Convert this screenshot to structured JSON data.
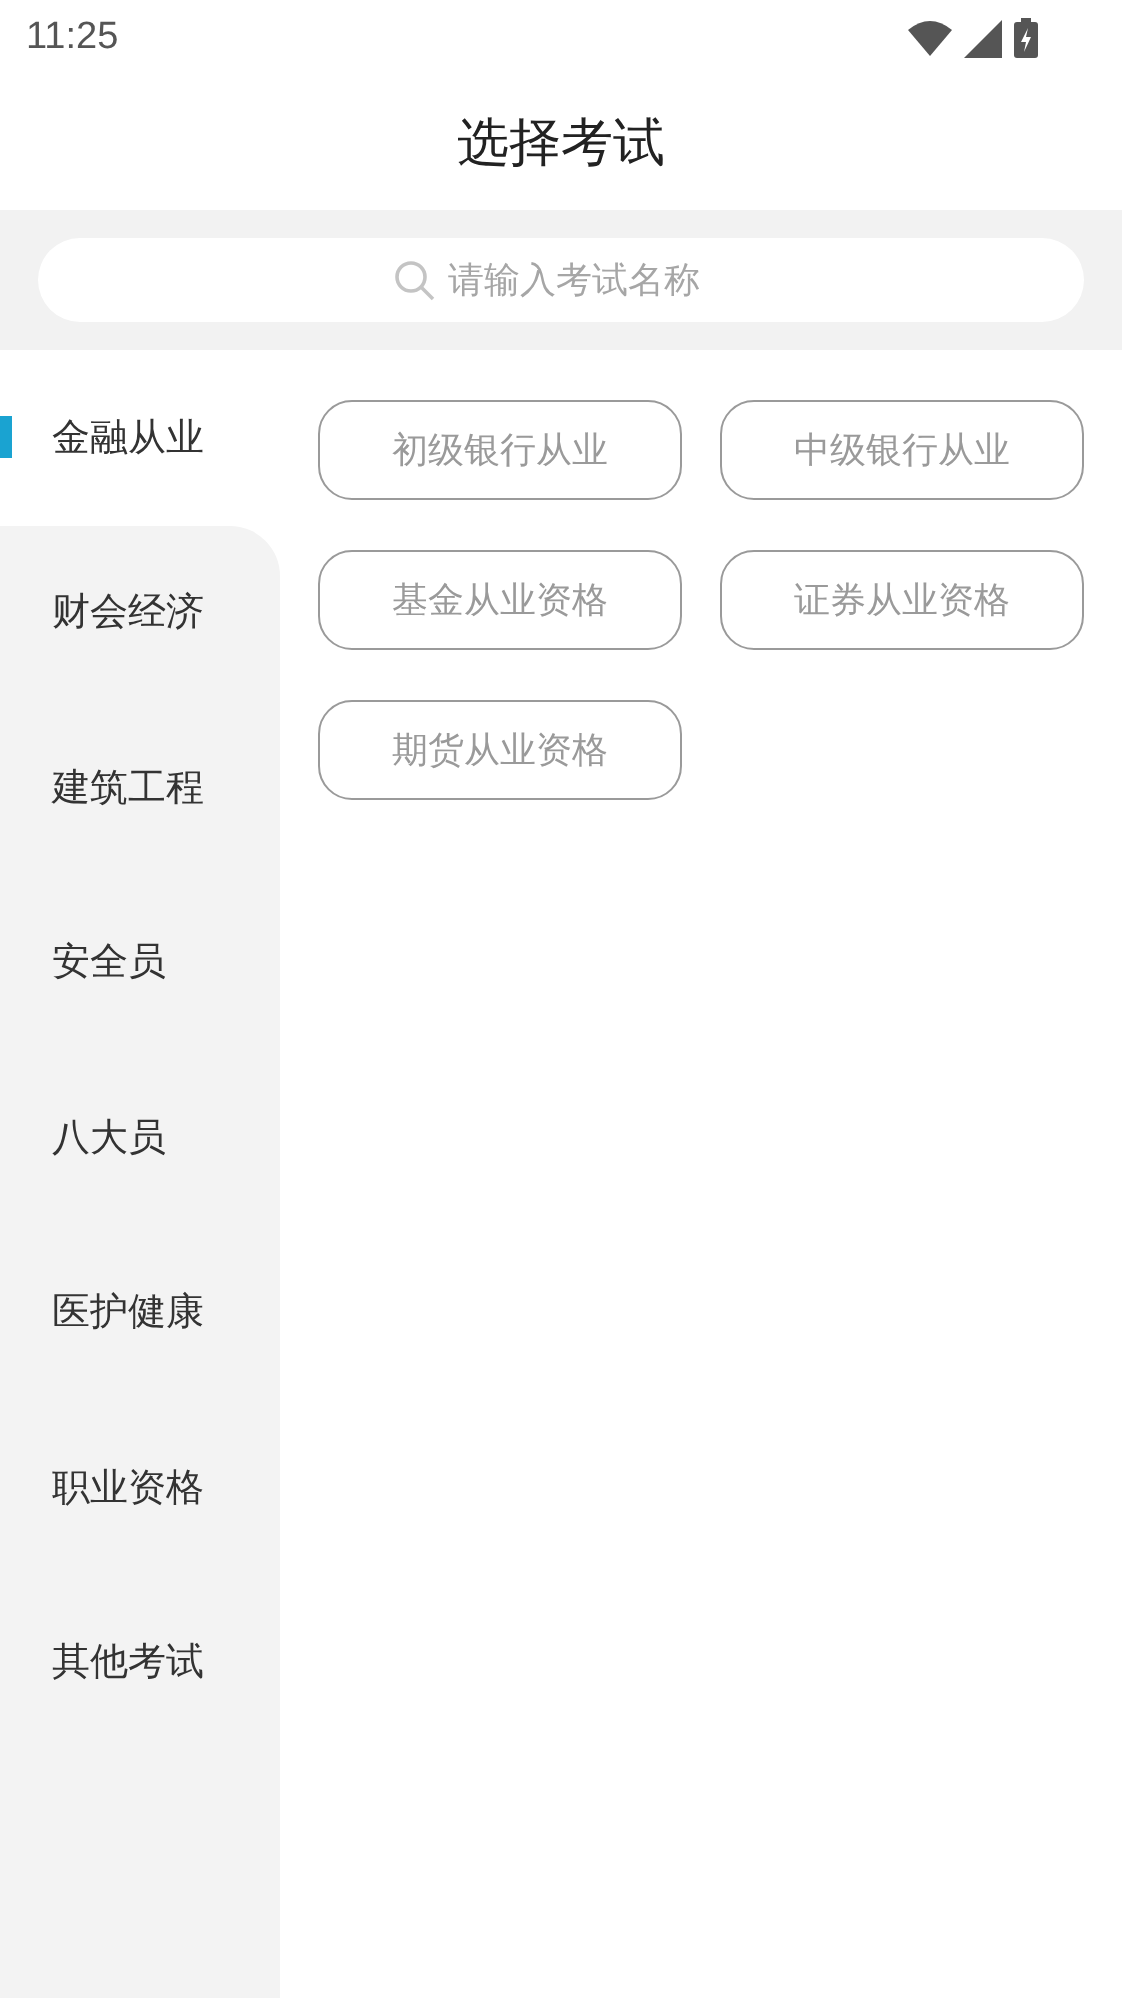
{
  "status_bar": {
    "time": "11:25"
  },
  "title": "选择考试",
  "search": {
    "placeholder": "请输入考试名称"
  },
  "categories": [
    {
      "label": "金融从业",
      "selected": true
    },
    {
      "label": "财会经济",
      "selected": false
    },
    {
      "label": "建筑工程",
      "selected": false
    },
    {
      "label": "安全员",
      "selected": false
    },
    {
      "label": "八大员",
      "selected": false
    },
    {
      "label": "医护健康",
      "selected": false
    },
    {
      "label": "职业资格",
      "selected": false
    },
    {
      "label": "其他考试",
      "selected": false
    }
  ],
  "exams": [
    "初级银行从业",
    "中级银行从业",
    "基金从业资格",
    "证券从业资格",
    "期货从业资格"
  ]
}
